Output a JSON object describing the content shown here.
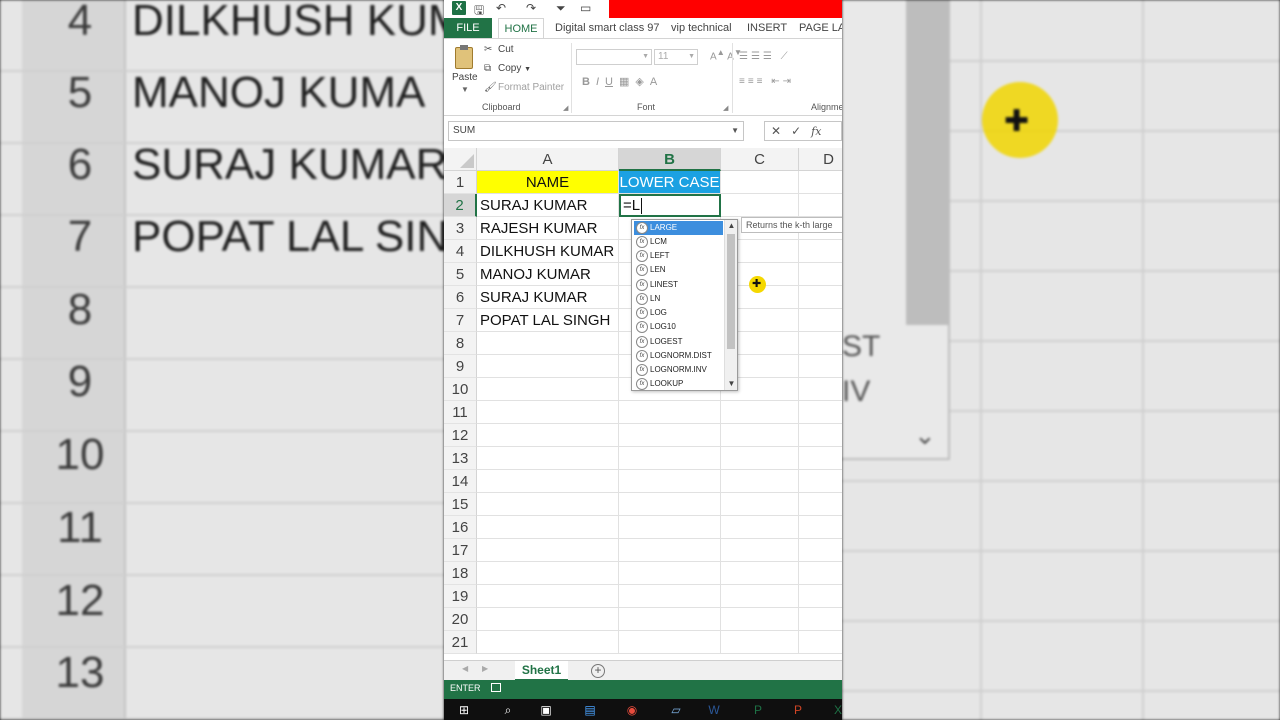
{
  "background": {
    "row_numbers": [
      "4",
      "5",
      "6",
      "7",
      "8",
      "9",
      "10",
      "11",
      "12",
      "13"
    ],
    "names": [
      "DILKHUSH KUM",
      "MANOJ KUMA",
      "SURAJ KUMAR",
      "POPAT LAL SIN"
    ],
    "right_fragments": [
      "ST",
      "IV"
    ]
  },
  "titlebar": {
    "app_icon": "X",
    "icons": [
      "save-icon",
      "undo-icon",
      "redo-icon",
      "filter-icon",
      "comment-icon"
    ]
  },
  "ribbon_tabs": [
    "FILE",
    "HOME",
    "Digital smart class 97",
    "vip technical",
    "INSERT",
    "PAGE LAY"
  ],
  "clipboard": {
    "paste_label": "Paste",
    "cut_label": "Cut",
    "copy_label": "Copy",
    "format_painter_label": "Format Painter",
    "group_label": "Clipboard"
  },
  "font_group": {
    "font_size": "11",
    "buttons": [
      "B",
      "I",
      "U"
    ],
    "group_label": "Font"
  },
  "alignment_group": {
    "group_label": "Alignme"
  },
  "formula_bar": {
    "name_box": "SUM",
    "cancel": "✕",
    "enter": "✓",
    "fx": "fx"
  },
  "columns": [
    "A",
    "B",
    "C",
    "D"
  ],
  "active_column": "B",
  "rows": [
    "1",
    "2",
    "3",
    "4",
    "5",
    "6",
    "7",
    "8",
    "9",
    "10",
    "11",
    "12",
    "13",
    "14",
    "15",
    "16",
    "17",
    "18",
    "19",
    "20",
    "21"
  ],
  "active_row": "2",
  "cells": {
    "A1": "NAME",
    "B1": "LOWER CASE",
    "A2": "SURAJ KUMAR",
    "B2": "=L",
    "A3": "RAJESH KUMAR",
    "A4": "DILKHUSH KUMAR",
    "A5": "MANOJ KUMAR",
    "A6": "SURAJ KUMAR",
    "A7": "POPAT LAL SINGH"
  },
  "autocomplete": {
    "items": [
      "LARGE",
      "LCM",
      "LEFT",
      "LEN",
      "LINEST",
      "LN",
      "LOG",
      "LOG10",
      "LOGEST",
      "LOGNORM.DIST",
      "LOGNORM.INV",
      "LOOKUP"
    ],
    "selected": "LARGE",
    "tooltip": "Returns the k-th large"
  },
  "sheet_tabs": {
    "active": "Sheet1",
    "add": "+"
  },
  "status": {
    "mode": "ENTER"
  },
  "colors": {
    "excel_green": "#217346",
    "header_yellow": "#ffff00",
    "header_blue": "#1ba1e2",
    "selection_blue": "#3c8ede",
    "accent_red": "#ff0000"
  }
}
